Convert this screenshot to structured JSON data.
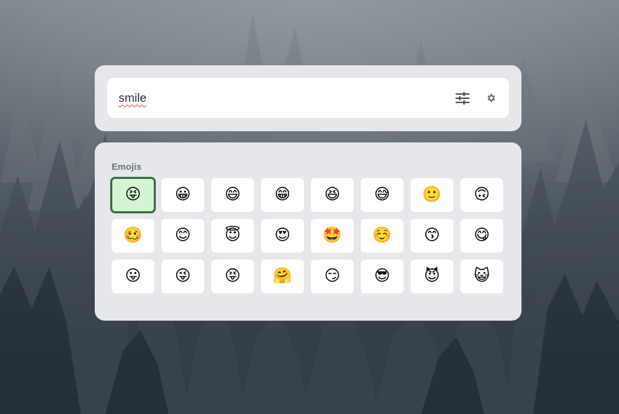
{
  "search": {
    "query": "smile",
    "filter_icon": "sliders-icon",
    "settings_icon": "gear-icon"
  },
  "results": {
    "section_label": "Emojis",
    "selected_index": 0,
    "emojis": [
      "😝",
      "😀",
      "😄",
      "😁",
      "😆",
      "😅",
      "🙂",
      "🙃",
      "🥴",
      "😊",
      "😇",
      "😍",
      "🤩",
      "☺️",
      "😙",
      "😋",
      "😛",
      "😜",
      "😝",
      "🤗",
      "😏",
      "😎",
      "😈",
      "😺"
    ]
  }
}
